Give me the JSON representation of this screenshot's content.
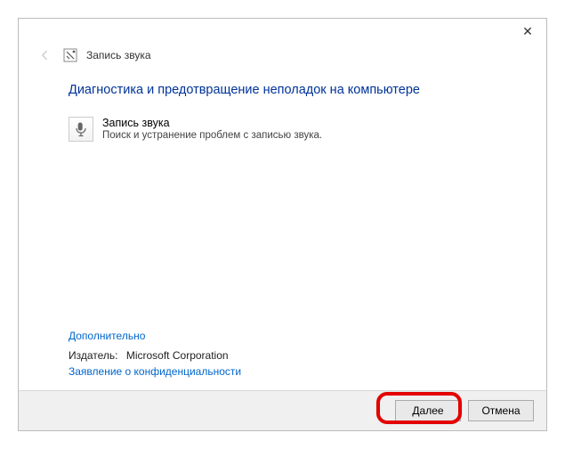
{
  "window": {
    "title": "Запись звука"
  },
  "main": {
    "heading": "Диагностика и предотвращение неполадок на компьютере",
    "item": {
      "title": "Запись звука",
      "description": "Поиск и устранение проблем с записью звука."
    },
    "advanced_link": "Дополнительно",
    "publisher_label": "Издатель:",
    "publisher_value": "Microsoft Corporation",
    "privacy_link": "Заявление о конфиденциальности"
  },
  "footer": {
    "next": "Далее",
    "cancel": "Отмена"
  }
}
